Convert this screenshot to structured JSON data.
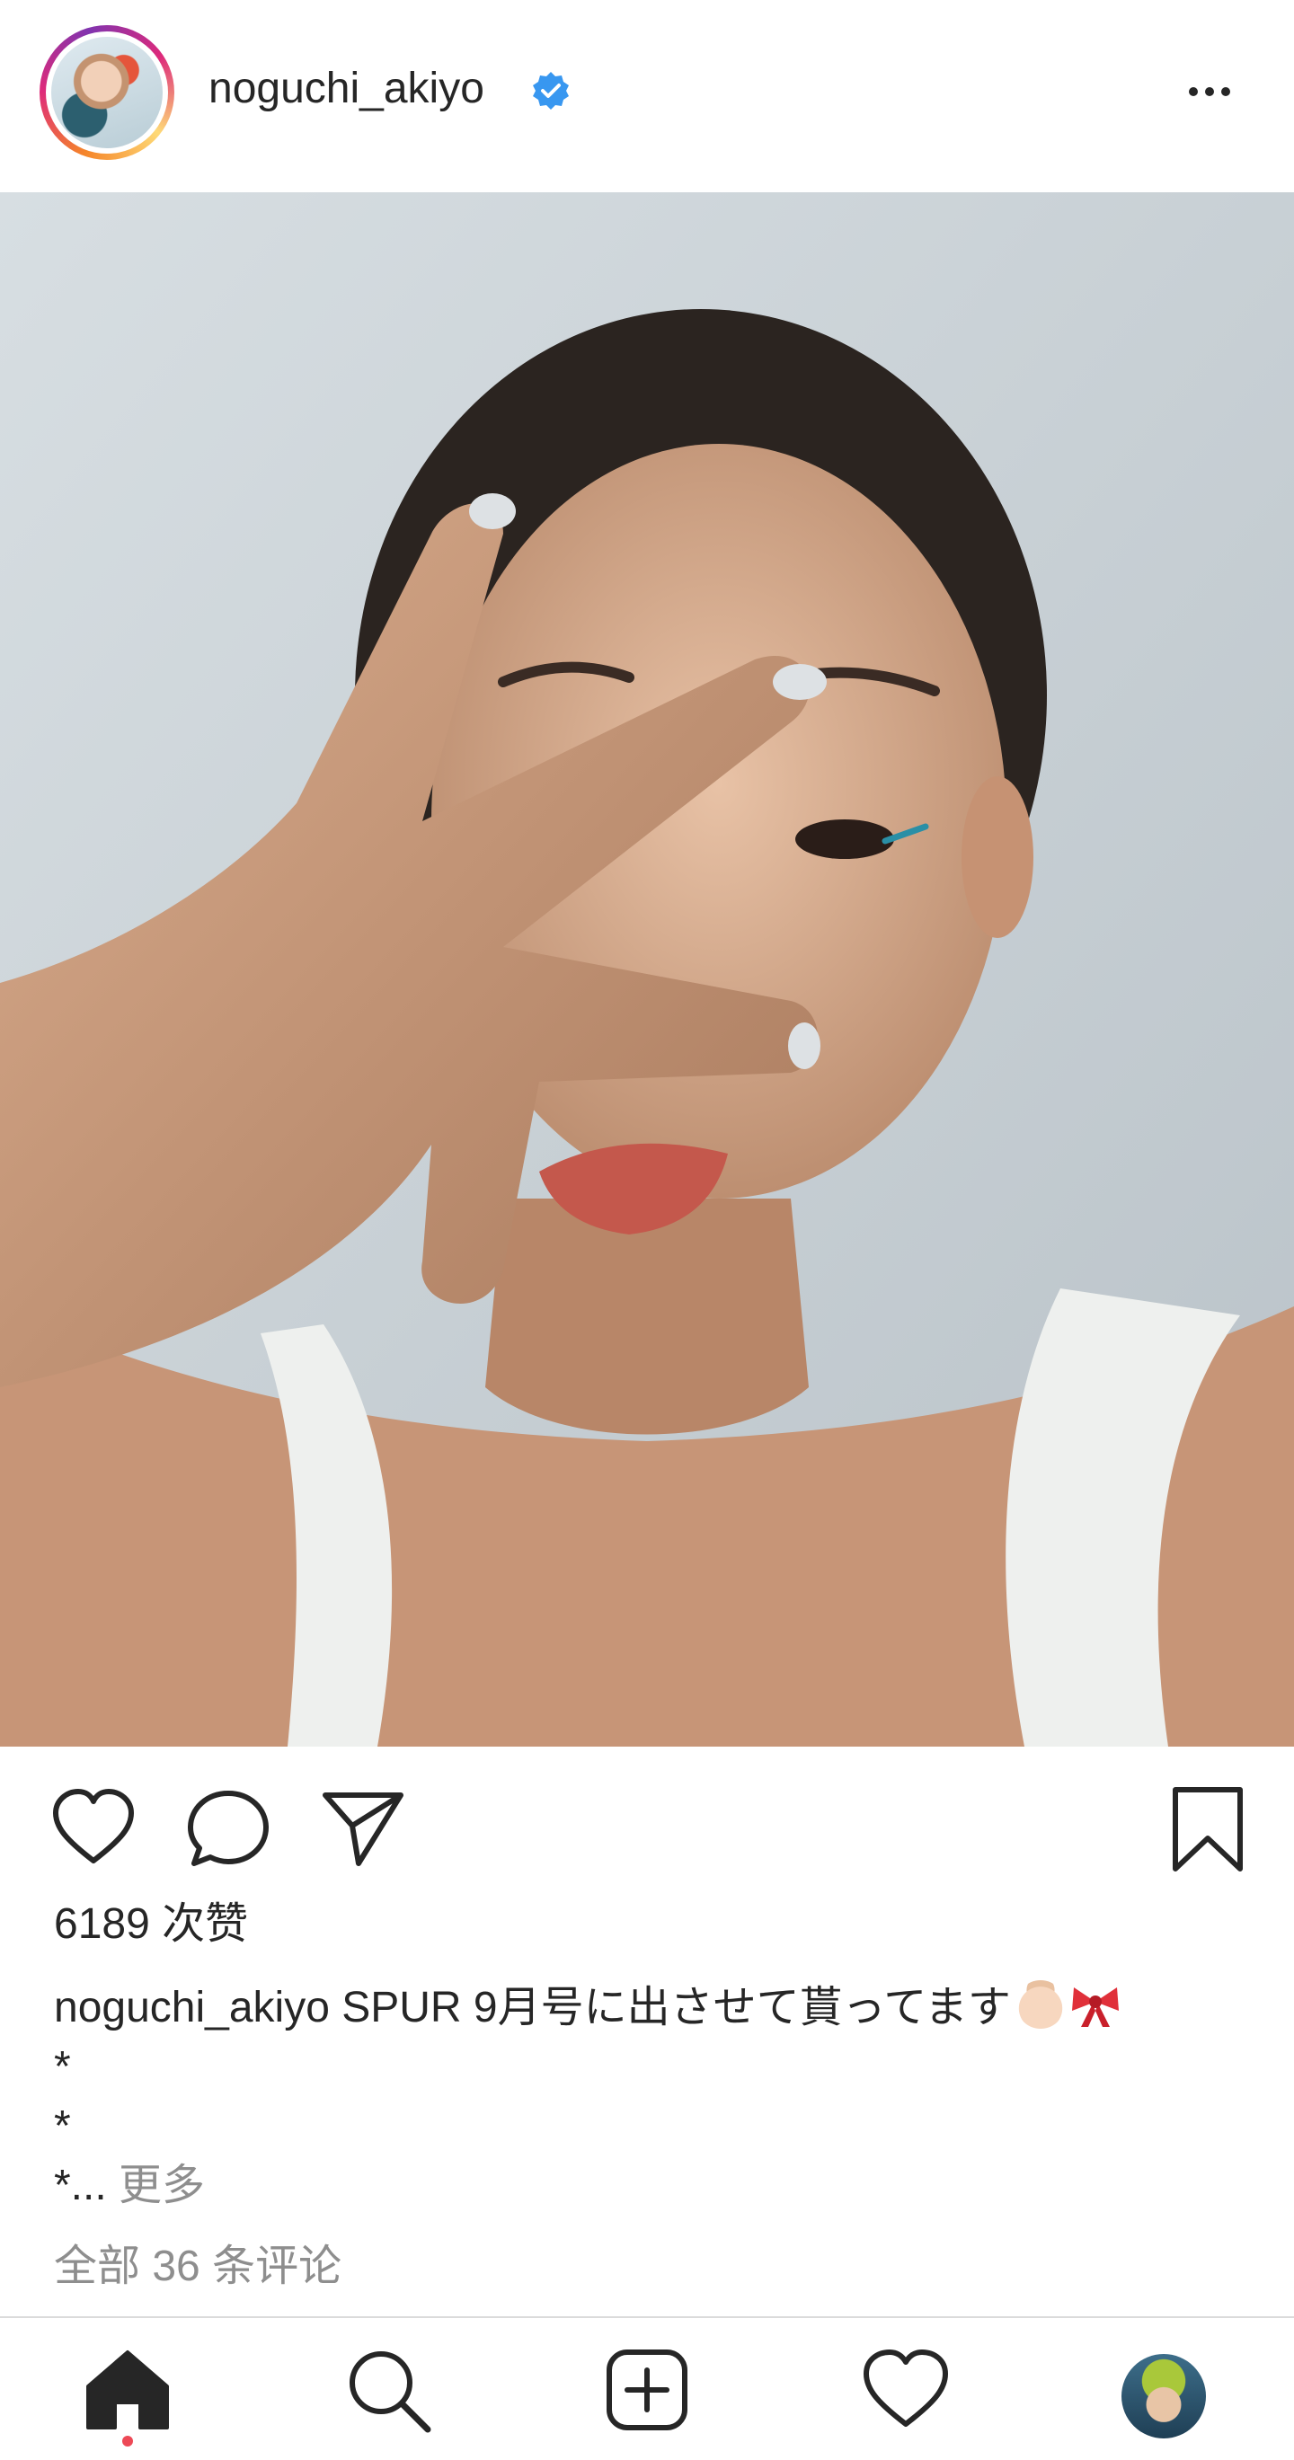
{
  "post": {
    "username": "noguchi_akiyo",
    "verified": true,
    "likes_text": "6189 次赞",
    "caption": {
      "username": "noguchi_akiyo",
      "text": "SPUR 9月号に出させて貰ってます",
      "star1": "*",
      "star2": "*",
      "star3": "*...",
      "more_label": "更多"
    },
    "comments_link": "全部 36 条评论"
  },
  "icons": {
    "header": [
      "avatar",
      "verified-badge-icon",
      "more-options-icon"
    ],
    "actions": [
      "heart-icon",
      "comment-icon",
      "share-icon",
      "bookmark-icon"
    ],
    "nav": [
      "home-icon",
      "search-icon",
      "new-post-icon",
      "activity-heart-icon",
      "profile-avatar"
    ]
  },
  "colors": {
    "verified": "#3897f0",
    "notification_dot": "#ed4956",
    "secondary_text": "#8e8e8e",
    "primary_text": "#262626"
  }
}
